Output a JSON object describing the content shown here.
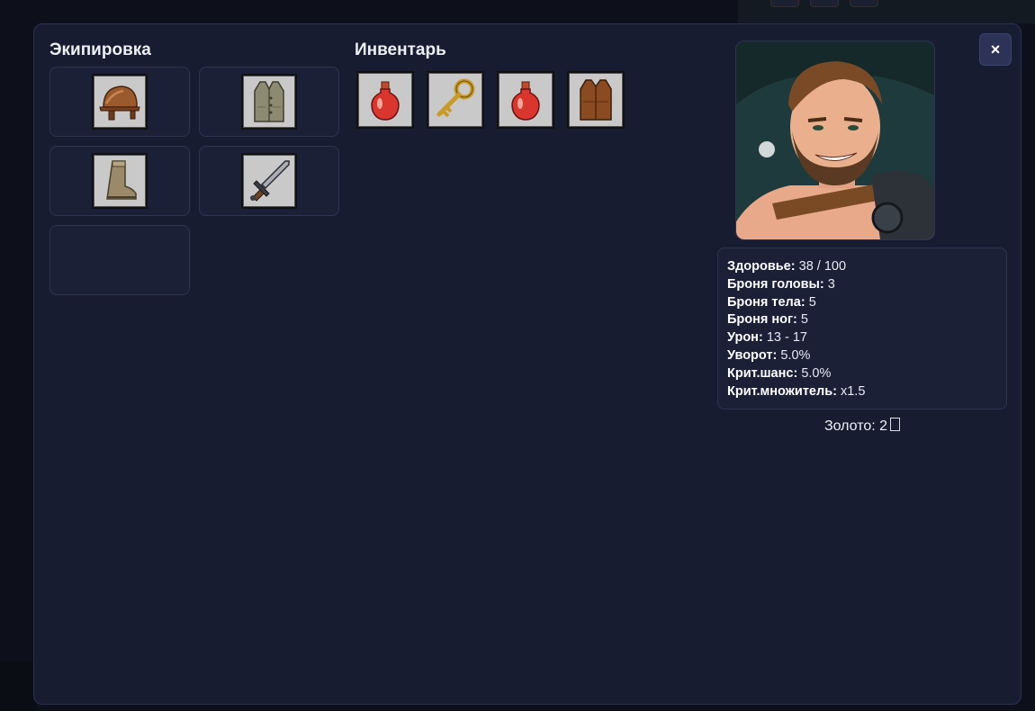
{
  "equipment": {
    "title": "Экипировка",
    "slots": [
      {
        "item": "helmet-icon"
      },
      {
        "item": "vest-icon"
      },
      {
        "item": "boot-icon"
      },
      {
        "item": "sword-icon"
      },
      {
        "item": null
      }
    ]
  },
  "inventory": {
    "title": "Инвентарь",
    "items": [
      {
        "item": "health-potion-icon"
      },
      {
        "item": "golden-key-icon"
      },
      {
        "item": "health-potion-icon"
      },
      {
        "item": "leather-vest-icon"
      }
    ]
  },
  "close_label": "×",
  "stats": [
    {
      "label": "Здоровье:",
      "value": "38 / 100"
    },
    {
      "label": "Броня головы:",
      "value": "3"
    },
    {
      "label": "Броня тела:",
      "value": "5"
    },
    {
      "label": "Броня ног:",
      "value": "5"
    },
    {
      "label": "Урон:",
      "value": "13 - 17"
    },
    {
      "label": "Уворот:",
      "value": "5.0%"
    },
    {
      "label": "Крит.шанс:",
      "value": "5.0%"
    },
    {
      "label": "Крит.множитель:",
      "value": "x1.5"
    }
  ],
  "gold": {
    "label": "Золото:",
    "value": "2"
  }
}
